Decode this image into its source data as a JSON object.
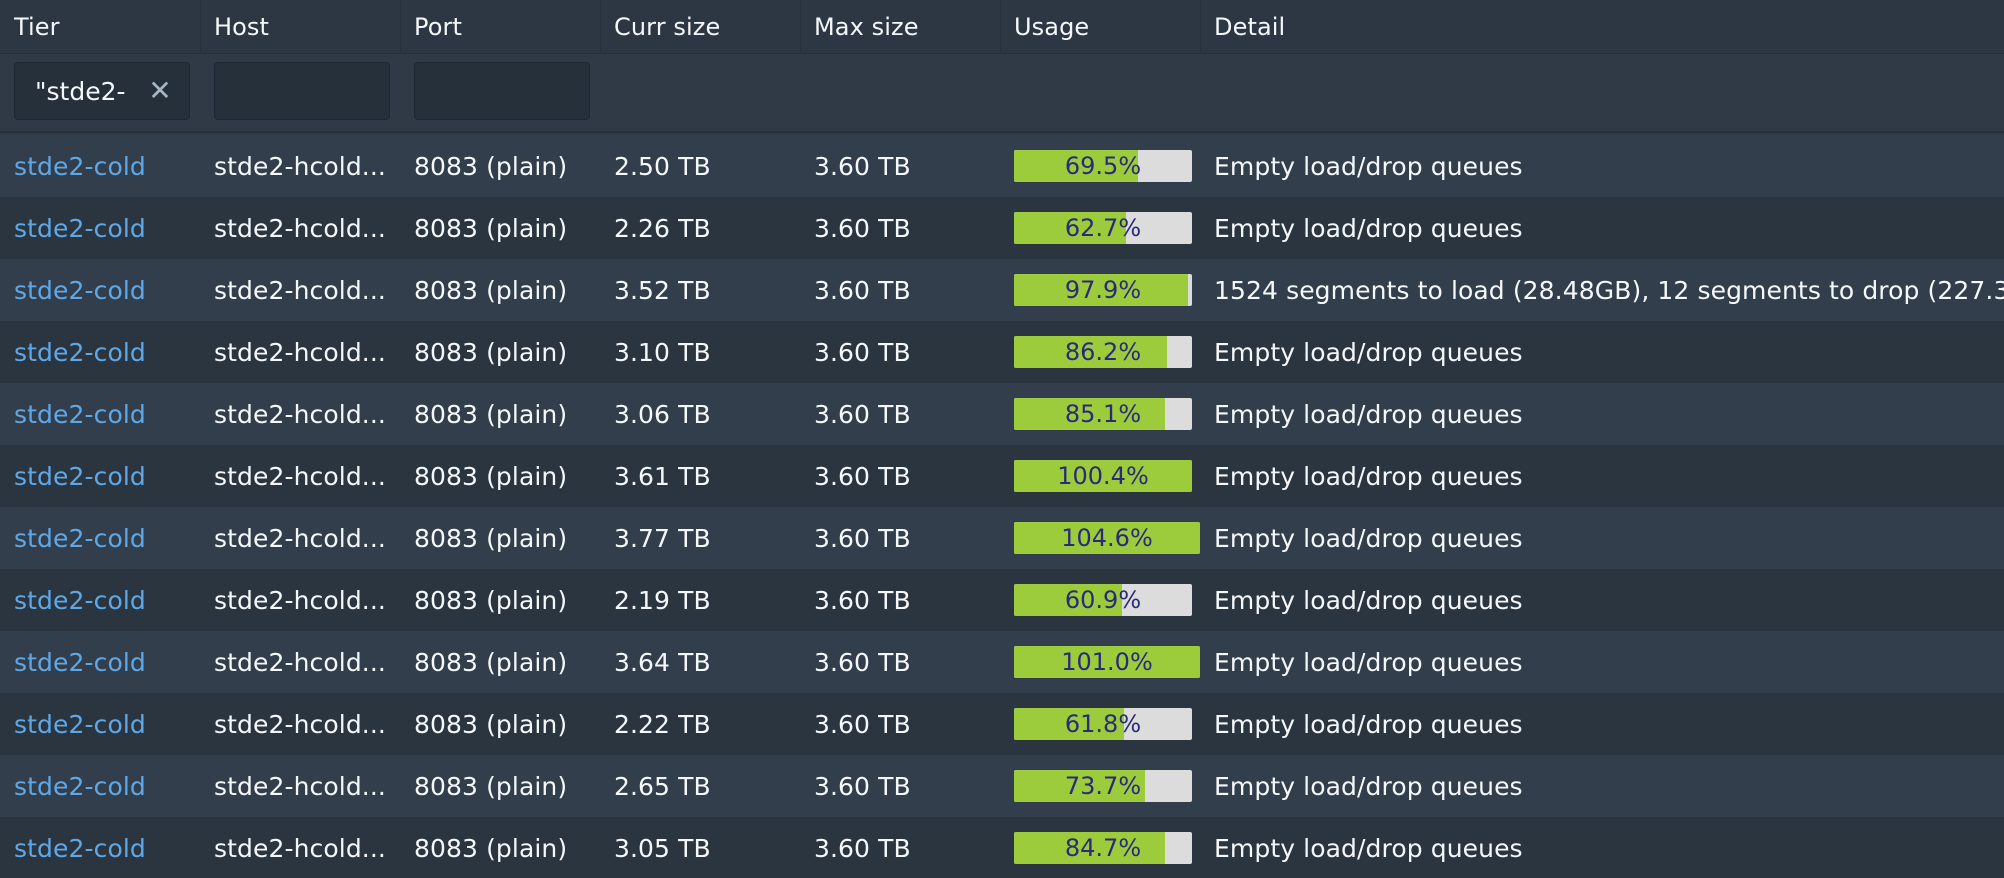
{
  "columns": [
    "Tier",
    "Host",
    "Port",
    "Curr size",
    "Max size",
    "Usage",
    "Detail"
  ],
  "filters": {
    "tier_value": "\"stde2-",
    "host_value": "",
    "port_value": ""
  },
  "rows": [
    {
      "tier": "stde2-cold",
      "host": "stde2-hcold...",
      "port": "8083 (plain)",
      "curr": "2.50 TB",
      "max": "3.60 TB",
      "usage": "69.5%",
      "usage_value": 69.5,
      "detail": "Empty load/drop queues"
    },
    {
      "tier": "stde2-cold",
      "host": "stde2-hcold...",
      "port": "8083 (plain)",
      "curr": "2.26 TB",
      "max": "3.60 TB",
      "usage": "62.7%",
      "usage_value": 62.7,
      "detail": "Empty load/drop queues"
    },
    {
      "tier": "stde2-cold",
      "host": "stde2-hcold...",
      "port": "8083 (plain)",
      "curr": "3.52 TB",
      "max": "3.60 TB",
      "usage": "97.9%",
      "usage_value": 97.9,
      "detail": "1524 segments to load (28.48GB), 12 segments to drop (227.3..."
    },
    {
      "tier": "stde2-cold",
      "host": "stde2-hcold...",
      "port": "8083 (plain)",
      "curr": "3.10 TB",
      "max": "3.60 TB",
      "usage": "86.2%",
      "usage_value": 86.2,
      "detail": "Empty load/drop queues"
    },
    {
      "tier": "stde2-cold",
      "host": "stde2-hcold...",
      "port": "8083 (plain)",
      "curr": "3.06 TB",
      "max": "3.60 TB",
      "usage": "85.1%",
      "usage_value": 85.1,
      "detail": "Empty load/drop queues"
    },
    {
      "tier": "stde2-cold",
      "host": "stde2-hcold...",
      "port": "8083 (plain)",
      "curr": "3.61 TB",
      "max": "3.60 TB",
      "usage": "100.4%",
      "usage_value": 100.4,
      "detail": "Empty load/drop queues"
    },
    {
      "tier": "stde2-cold",
      "host": "stde2-hcold...",
      "port": "8083 (plain)",
      "curr": "3.77 TB",
      "max": "3.60 TB",
      "usage": "104.6%",
      "usage_value": 104.6,
      "detail": "Empty load/drop queues"
    },
    {
      "tier": "stde2-cold",
      "host": "stde2-hcold...",
      "port": "8083 (plain)",
      "curr": "2.19 TB",
      "max": "3.60 TB",
      "usage": "60.9%",
      "usage_value": 60.9,
      "detail": "Empty load/drop queues"
    },
    {
      "tier": "stde2-cold",
      "host": "stde2-hcold...",
      "port": "8083 (plain)",
      "curr": "3.64 TB",
      "max": "3.60 TB",
      "usage": "101.0%",
      "usage_value": 101.0,
      "detail": "Empty load/drop queues"
    },
    {
      "tier": "stde2-cold",
      "host": "stde2-hcold...",
      "port": "8083 (plain)",
      "curr": "2.22 TB",
      "max": "3.60 TB",
      "usage": "61.8%",
      "usage_value": 61.8,
      "detail": "Empty load/drop queues"
    },
    {
      "tier": "stde2-cold",
      "host": "stde2-hcold...",
      "port": "8083 (plain)",
      "curr": "2.65 TB",
      "max": "3.60 TB",
      "usage": "73.7%",
      "usage_value": 73.7,
      "detail": "Empty load/drop queues"
    },
    {
      "tier": "stde2-cold",
      "host": "stde2-hcold...",
      "port": "8083 (plain)",
      "curr": "3.05 TB",
      "max": "3.60 TB",
      "usage": "84.7%",
      "usage_value": 84.7,
      "detail": "Empty load/drop queues"
    }
  ],
  "colors": {
    "background": "#2f3a46",
    "link": "#5fa8e8",
    "usage_fill": "#9ccc3c",
    "usage_track": "#dcdcdc",
    "usage_text": "#2a2a7a"
  },
  "icons": {
    "filter_clear": "close-icon"
  }
}
